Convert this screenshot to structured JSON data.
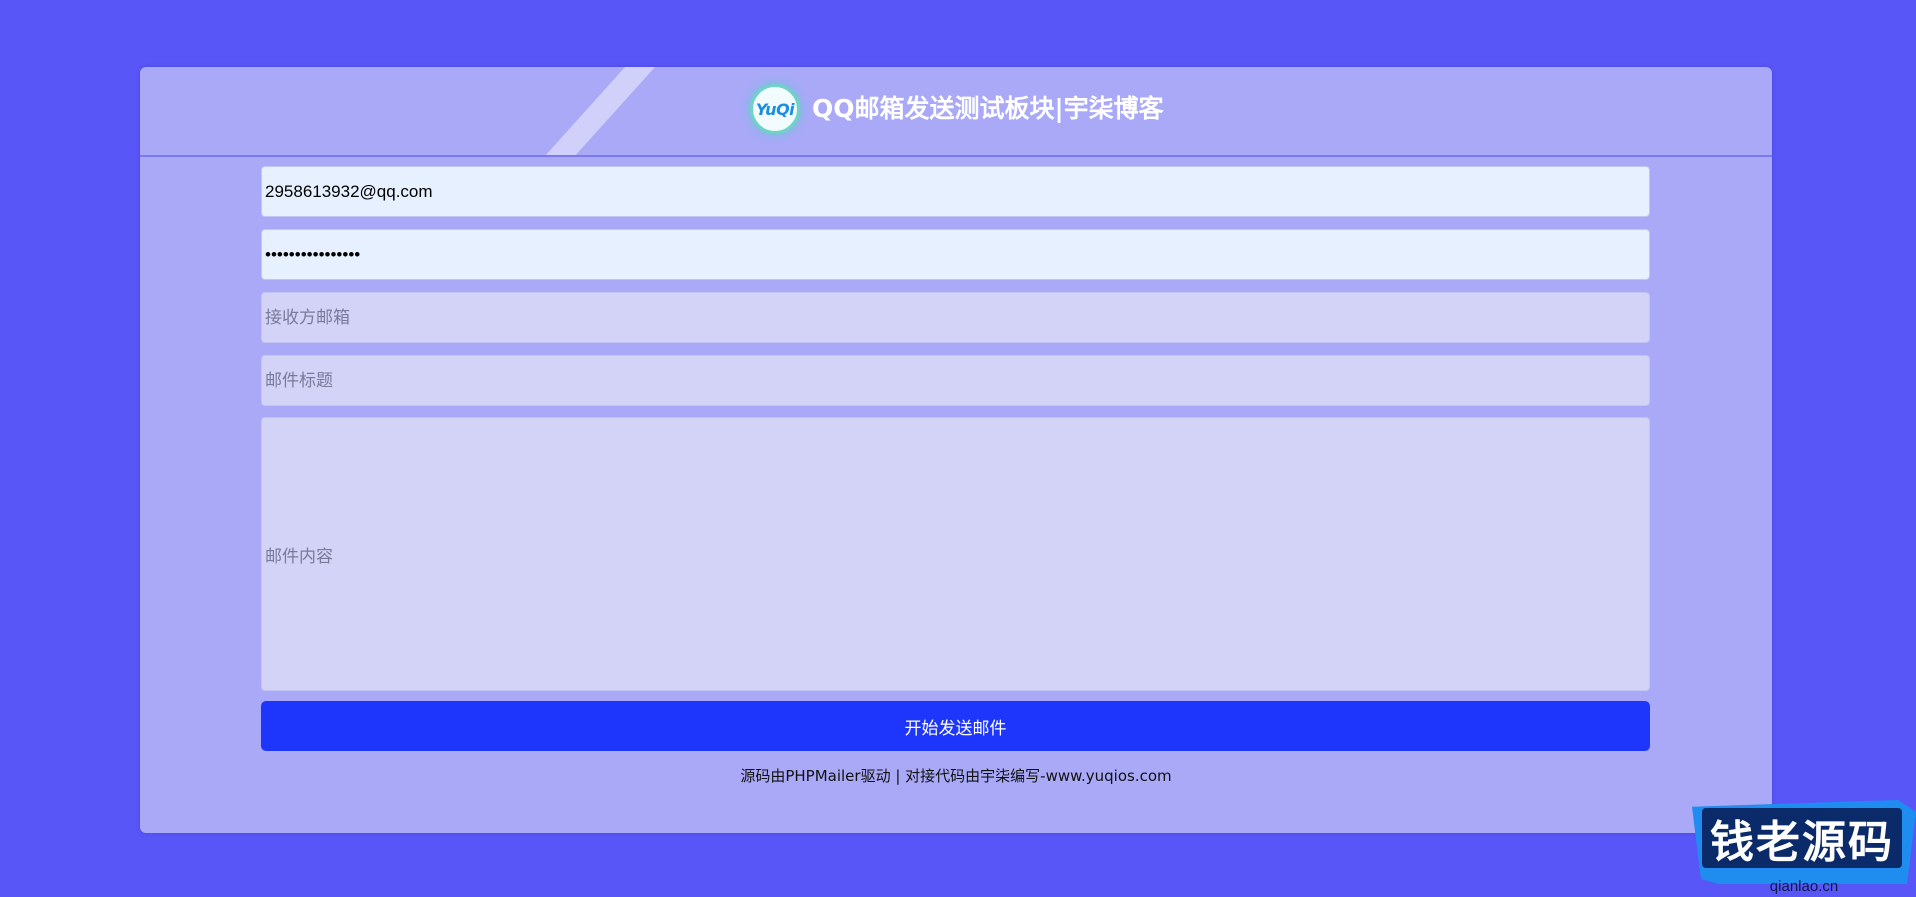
{
  "header": {
    "logo_text": "YuQi",
    "title": "QQ邮箱发送测试板块|宇柒博客"
  },
  "form": {
    "sender_email": {
      "value": "2958613932@qq.com"
    },
    "password": {
      "value": "••••••••••••••••"
    },
    "recipient_email": {
      "placeholder": "接收方邮箱"
    },
    "subject": {
      "placeholder": "邮件标题"
    },
    "content": {
      "placeholder": "邮件内容"
    },
    "send_button_label": "开始发送邮件"
  },
  "footer": {
    "credit": "源码由PHPMailer驱动 | 对接代码由宇柒编写-www.yuqios.com"
  },
  "watermark": {
    "text": "钱老源码",
    "url": "qianlao.cn"
  },
  "colors": {
    "page_background": "#5856f6",
    "card_background": "#a9a9f8",
    "button": "#1e36fb",
    "input_filled": "#e7f0fe",
    "input_empty": "#d3d3f8"
  }
}
